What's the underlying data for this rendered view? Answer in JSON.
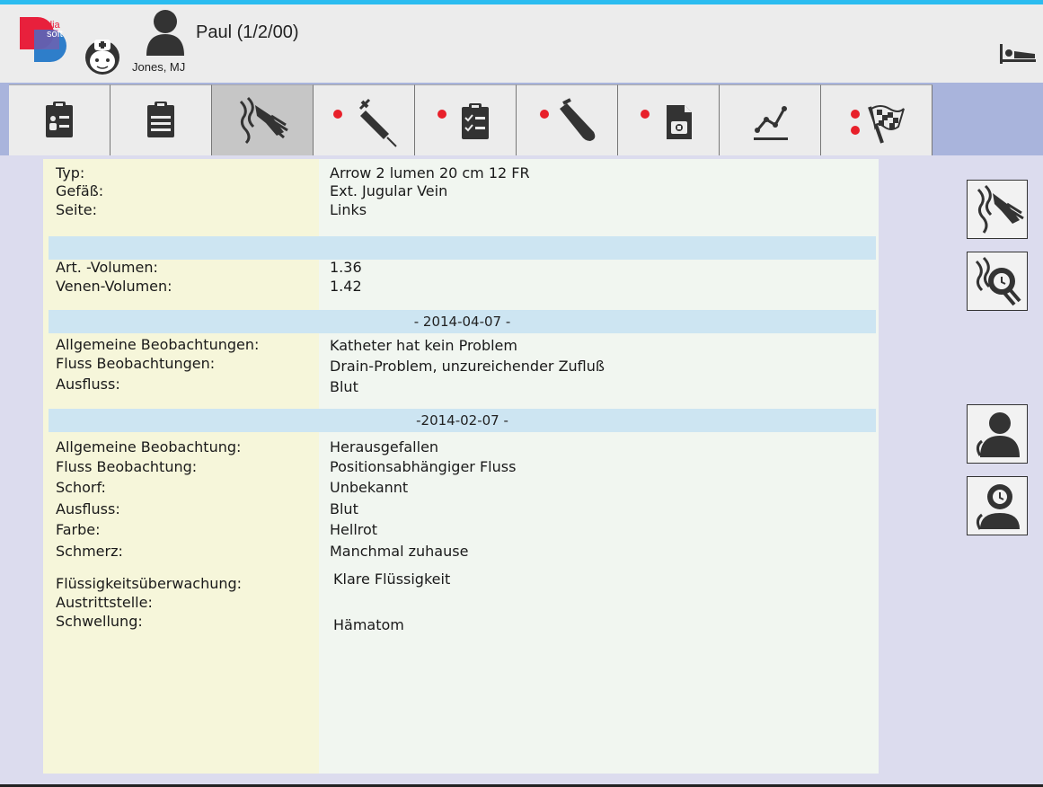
{
  "header": {
    "logo_text_top": "dia",
    "logo_text_bottom": "soft",
    "patient_name": "Paul (1/2/00)",
    "doctor_name": "Jones, MJ"
  },
  "tabs": [
    {
      "icon": "patient-clipboard-icon",
      "alert": false,
      "active": false
    },
    {
      "icon": "clipboard-icon",
      "alert": false,
      "active": false
    },
    {
      "icon": "catheter-arm-icon",
      "alert": false,
      "active": true
    },
    {
      "icon": "syringe-icon",
      "alert": true,
      "active": false
    },
    {
      "icon": "checklist-icon",
      "alert": true,
      "active": false
    },
    {
      "icon": "test-tube-icon",
      "alert": true,
      "active": false
    },
    {
      "icon": "medical-document-icon",
      "alert": true,
      "active": false
    },
    {
      "icon": "trend-chart-icon",
      "alert": false,
      "active": false
    },
    {
      "icon": "checkered-flag-icon",
      "alert": true,
      "active": false
    }
  ],
  "catheter": {
    "typ_label": "Typ:",
    "typ_value": "Arrow 2 lumen 20 cm 12 FR",
    "gefaess_label": "Gefäß:",
    "gefaess_value": "Ext. Jugular Vein",
    "seite_label": "Seite:",
    "seite_value": "Links"
  },
  "volumes": {
    "art_label": "Art. -Volumen:",
    "art_value": "1.36",
    "venen_label": "Venen-Volumen:",
    "venen_value": "1.42"
  },
  "obs1": {
    "date": "- 2014-04-07 -",
    "allgemein_label": "Allgemeine Beobachtungen:",
    "allgemein_value": "Katheter hat kein Problem",
    "fluss_label": "Fluss Beobachtungen:",
    "fluss_value": "Drain-Problem, unzureichender Zufluß",
    "ausfluss_label": "Ausfluss:",
    "ausfluss_value": "Blut"
  },
  "obs2": {
    "date": "-2014-02-07 -",
    "allgemein_label": "Allgemeine Beobachtung:",
    "allgemein_value": "Herausgefallen",
    "fluss_label": "Fluss Beobachtung:",
    "fluss_value": "Positionsabhängiger Fluss",
    "schorf_label": "Schorf:",
    "schorf_value": "Unbekannt",
    "ausfluss_label": "Ausfluss:",
    "ausfluss_value": "Blut",
    "farbe_label": "Farbe:",
    "farbe_value": "Hellrot",
    "schmerz_label": "Schmerz:",
    "schmerz_value": "Manchmal zuhause",
    "fluessigkeit_label": "Flüssigkeitsüberwachung:",
    "fluessigkeit_value": "Klare Flüssigkeit",
    "austritt_label": "Austrittstelle:",
    "schwellung_label": "Schwellung:",
    "schwellung_value": "Hämatom"
  },
  "colors": {
    "accent_top": "#2bbcf0",
    "alert_dot": "#e8202a",
    "logo_red": "#e8203c",
    "logo_blue": "#2478c8",
    "band": "#cde5f2",
    "label_column": "#f6f6da"
  }
}
